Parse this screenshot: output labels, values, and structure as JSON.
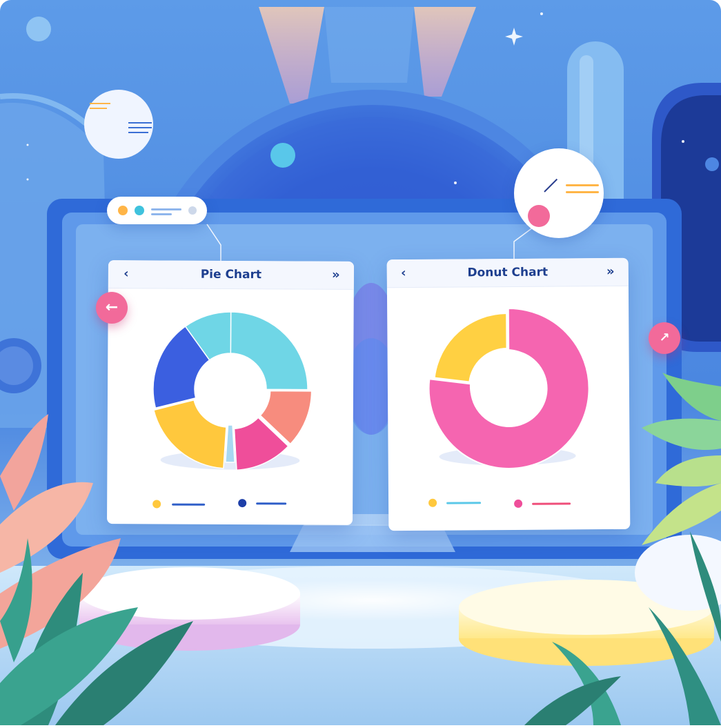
{
  "colors": {
    "accent_blue": "#1e3f8f",
    "pink": "#f26a9a",
    "cyan": "#6fd6e6",
    "coral": "#f78c7e",
    "magenta": "#ef4e9a",
    "royal_blue": "#3b5fe0",
    "yellow": "#ffc83d",
    "light_blue_slice": "#a8d8f2"
  },
  "icons": {
    "back": "chevron-left-icon",
    "forward": "double-chevron-right-icon",
    "arrow_left": "arrow-left-icon",
    "arrow_up_right": "arrow-up-right-icon"
  },
  "pie_panel": {
    "title": "Pie Chart",
    "back_glyph": "‹",
    "forward_glyph": "»"
  },
  "donut_panel": {
    "title": "Donut Chart",
    "back_glyph": "‹",
    "forward_glyph": "»"
  },
  "left_round_button": {
    "glyph": "←"
  },
  "right_round_button": {
    "glyph": "↗"
  },
  "chart_data": [
    {
      "type": "pie",
      "title": "Pie Chart",
      "slices": [
        {
          "color": "#6fd6e6",
          "value": 0.25
        },
        {
          "color": "#f78c7e",
          "value": 0.12
        },
        {
          "color": "#ef4e9a",
          "value": 0.12
        },
        {
          "color": "#a8d8f2",
          "value": 0.02
        },
        {
          "color": "#ffc83d",
          "value": 0.2
        },
        {
          "color": "#3b5fe0",
          "value": 0.19
        },
        {
          "color": "#6fd6e6",
          "value": 0.1
        }
      ],
      "legend": [
        {
          "color": "#ffc83d",
          "line_color": "#2f5ec8"
        },
        {
          "color": "#1e3fa8",
          "line_color": "#2f5ec8"
        }
      ]
    },
    {
      "type": "pie",
      "title": "Donut Chart",
      "slices": [
        {
          "color": "#f565b0",
          "value": 0.77
        },
        {
          "color": "#ffd042",
          "value": 0.23
        }
      ],
      "legend": [
        {
          "color": "#ffc83d",
          "line_color": "#5bc8e8"
        },
        {
          "color": "#ef4e9a",
          "line_color": "#ef4e7a"
        }
      ]
    }
  ]
}
